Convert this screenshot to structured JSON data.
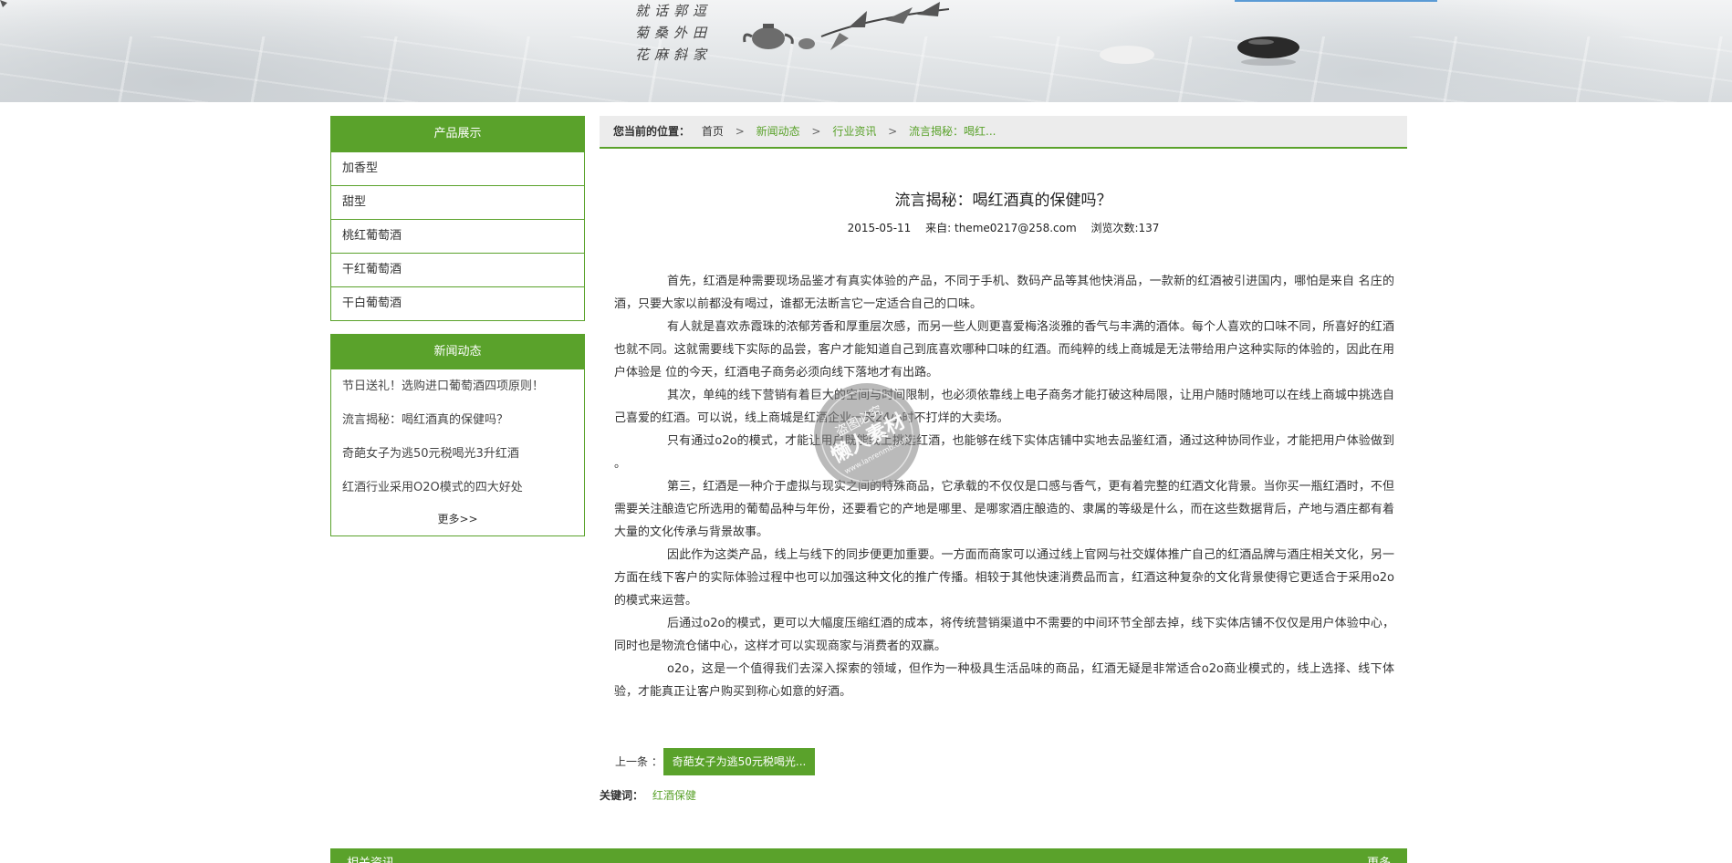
{
  "banner": {
    "poem_lines": [
      "就话郭逗",
      "菊桑外田",
      "花麻斜家"
    ]
  },
  "sidebar": {
    "products": {
      "title": "产品展示",
      "items": [
        "加香型",
        "甜型",
        "桃红葡萄酒",
        "干红葡萄酒",
        "干白葡萄酒"
      ]
    },
    "news": {
      "title": "新闻动态",
      "items": [
        "节日送礼！选购进口葡萄酒四项原则！",
        "流言揭秘：喝红酒真的保健吗？",
        "奇葩女子为逃50元税喝光3升红酒",
        "红酒行业采用O2O模式的四大好处"
      ],
      "more": "更多>>"
    }
  },
  "breadcrumb": {
    "label": "您当前的位置：",
    "items": [
      "首页",
      "新闻动态",
      "行业资讯",
      "流言揭秘：喝红..."
    ],
    "separator": ">"
  },
  "article": {
    "title": "流言揭秘：喝红酒真的保健吗？",
    "date": "2015-05-11",
    "source": "来自: theme0217@258.com",
    "views": "浏览次数:137",
    "paragraphs": [
      "首先，红酒是种需要现场品鉴才有真实体验的产品，不同于手机、数码产品等其他快消品，一款新的红酒被引进国内，哪怕是来自 名庄的酒，只要大家以前都没有喝过，谁都无法断言它一定适合自己的口味。",
      "有人就是喜欢赤霞珠的浓郁芳香和厚重层次感，而另一些人则更喜爱梅洛淡雅的香气与丰满的酒体。每个人喜欢的口味不同，所喜好的红酒也就不同。这就需要线下实际的品尝，客户才能知道自己到底喜欢哪种口味的红酒。而纯粹的线上商城是无法带给用户这种实际的体验的，因此在用户体验是 位的今天，红酒电子商务必须向线下落地才有出路。",
      "其次，单纯的线下营销有着巨大的空间与时间限制，也必须依靠线上电子商务才能打破这种局限，让用户随时随地可以在线上商城中挑选自己喜爱的红酒。可以说，线上商城是红酒企业一天24小时不打烊的大卖场。",
      "只有通过o2o的模式，才能让用户既能线上挑选红酒，也能够在线下实体店铺中实地去品鉴红酒，通过这种协同作业，才能把用户体验做到 。",
      "第三，红酒是一种介于虚拟与现实之间的特殊商品，它承载的不仅仅是口感与香气，更有着完整的红酒文化背景。当你买一瓶红酒时，不但需要关注酿造它所选用的葡萄品种与年份，还要看它的产地是哪里、是哪家酒庄酿造的、隶属的等级是什么，而在这些数据背后，产地与酒庄都有着大量的文化传承与背景故事。",
      "因此作为这类产品，线上与线下的同步便更加重要。一方面而商家可以通过线上官网与社交媒体推广自己的红酒品牌与酒庄相关文化，另一方面在线下客户的实际体验过程中也可以加强这种文化的推广传播。相较于其他快速消费品而言，红酒这种复杂的文化背景使得它更适合于采用o2o的模式来运营。",
      " 后通过o2o的模式，更可以大幅度压缩红酒的成本，将传统营销渠道中不需要的中间环节全部去掉，线下实体店铺不仅仅是用户体验中心，同时也是物流仓储中心，这样才可以实现商家与消费者的双赢。",
      "o2o，这是一个值得我们去深入探索的领域，但作为一种极具生活品味的商品，红酒无疑是非常适合o2o商业模式的，线上选择、线下体验，才能真正让客户购买到称心如意的好酒。"
    ]
  },
  "pager": {
    "prev_label": "上一条 ：",
    "prev_title": "奇葩女子为逃50元税喝光..."
  },
  "keywords": {
    "label": "关键词：",
    "value": "红酒保健"
  },
  "footer": {
    "left": "相关资讯",
    "right": "更多"
  },
  "watermark": {
    "line1": "懒人素材",
    "line2": "盗图必究",
    "site": "www.lanrenmb.com"
  },
  "colors": {
    "accent": "#5aa22b",
    "breadcrumb_bg": "#ececec"
  }
}
